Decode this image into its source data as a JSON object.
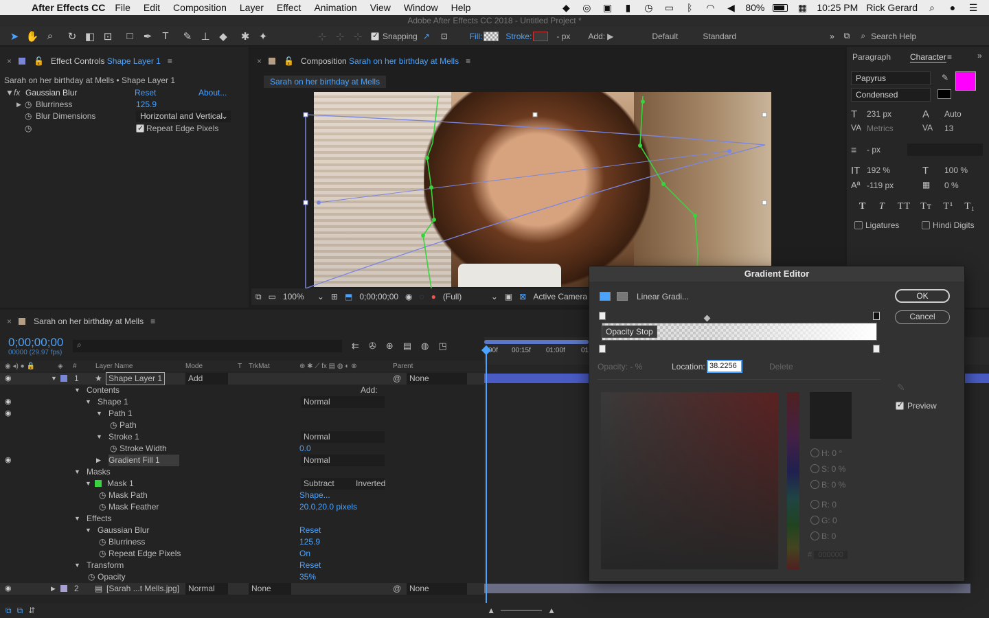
{
  "menubar": {
    "app_name": "After Effects CC",
    "items": [
      "File",
      "Edit",
      "Composition",
      "Layer",
      "Effect",
      "Animation",
      "View",
      "Window",
      "Help"
    ],
    "battery": "80%",
    "time": "10:25 PM",
    "user": "Rick Gerard"
  },
  "title_strip": "Adobe After Effects CC 2018 - Untitled Project *",
  "toolbar": {
    "snapping": "Snapping",
    "fill": "Fill:",
    "stroke": "Stroke:",
    "px": "- px",
    "add": "Add:",
    "workspace_default": "Default",
    "workspace_standard": "Standard",
    "search_help": "Search Help"
  },
  "effect_controls": {
    "tab_prefix": "Effect Controls",
    "tab_layer": "Shape Layer 1",
    "breadcrumb": "Sarah on her birthday at Mells • Shape Layer 1",
    "effect_name": "Gaussian Blur",
    "reset": "Reset",
    "about": "About...",
    "blurriness_label": "Blurriness",
    "blurriness_value": "125.9",
    "blur_dimensions_label": "Blur Dimensions",
    "blur_dimensions_value": "Horizontal and Vertical",
    "repeat_edge": "Repeat Edge Pixels"
  },
  "composition": {
    "tab_prefix": "Composition",
    "tab_name": "Sarah on her birthday at Mells",
    "subtab": "Sarah on her birthday at Mells",
    "zoom": "100%",
    "timecode": "0;00;00;00",
    "resolution": "(Full)",
    "camera": "Active Camera"
  },
  "character": {
    "tab_paragraph": "Paragraph",
    "tab_character": "Character",
    "font_family": "Papyrus",
    "font_style": "Condensed",
    "font_size": "231 px",
    "leading": "Auto",
    "kerning": "Metrics",
    "tracking": "13",
    "stroke_width": "- px",
    "vert_scale": "192 %",
    "horiz_scale": "100 %",
    "baseline": "-119 px",
    "tsume": "0 %",
    "ligatures": "Ligatures",
    "hindi_digits": "Hindi Digits",
    "fill_color": "#ff00ff"
  },
  "timeline": {
    "tab": "Sarah on her birthday at Mells",
    "timecode": "0;00;00;00",
    "fps": "00000 (29.97 fps)",
    "headers": {
      "num": "#",
      "layer_name": "Layer Name",
      "mode": "Mode",
      "t": "T",
      "trkmat": "TrkMat",
      "parent": "Parent"
    },
    "ruler": [
      "00f",
      "00:15f",
      "01:00f",
      "01"
    ],
    "rows": [
      {
        "indent": 0,
        "num": "1",
        "name": "Shape Layer 1",
        "mode": "Add",
        "parent": "None",
        "type": "layer"
      },
      {
        "indent": 1,
        "name": "Contents",
        "extra": "Add:"
      },
      {
        "indent": 2,
        "name": "Shape 1",
        "mode": "Normal"
      },
      {
        "indent": 3,
        "name": "Path 1"
      },
      {
        "indent": 4,
        "name": "Path"
      },
      {
        "indent": 3,
        "name": "Stroke 1",
        "mode": "Normal"
      },
      {
        "indent": 4,
        "name": "Stroke Width",
        "value": "0.0"
      },
      {
        "indent": 3,
        "name": "Gradient Fill 1",
        "mode": "Normal",
        "selected": true
      },
      {
        "indent": 1,
        "name": "Masks"
      },
      {
        "indent": 2,
        "name": "Mask 1",
        "mode": "Subtract",
        "extra": "Inverted"
      },
      {
        "indent": 3,
        "name": "Mask Path",
        "value": "Shape..."
      },
      {
        "indent": 3,
        "name": "Mask Feather",
        "value": "20.0,20.0 pixels"
      },
      {
        "indent": 1,
        "name": "Effects"
      },
      {
        "indent": 2,
        "name": "Gaussian Blur",
        "value": "Reset"
      },
      {
        "indent": 3,
        "name": "Blurriness",
        "value": "125.9"
      },
      {
        "indent": 3,
        "name": "Repeat Edge Pixels",
        "value": "On"
      },
      {
        "indent": 1,
        "name": "Transform",
        "value": "Reset"
      },
      {
        "indent": 2,
        "name": "Opacity",
        "value": "35%"
      },
      {
        "indent": 0,
        "num": "2",
        "name": "[Sarah ...t Mells.jpg]",
        "mode": "Normal",
        "trkmat": "None",
        "parent": "None",
        "type": "layer"
      }
    ]
  },
  "gradient_editor": {
    "title": "Gradient Editor",
    "type_label": "Linear Gradi...",
    "ok": "OK",
    "cancel": "Cancel",
    "tooltip": "Opacity Stop",
    "opacity_label": "Opacity: - %",
    "location_label": "Location:",
    "location_value": "38.2256",
    "delete": "Delete",
    "preview": "Preview",
    "h": "H: 0 °",
    "s": "S: 0 %",
    "b": "B: 0 %",
    "r": "R: 0",
    "g": "G: 0",
    "bb": "B: 0",
    "hex": "000000"
  }
}
